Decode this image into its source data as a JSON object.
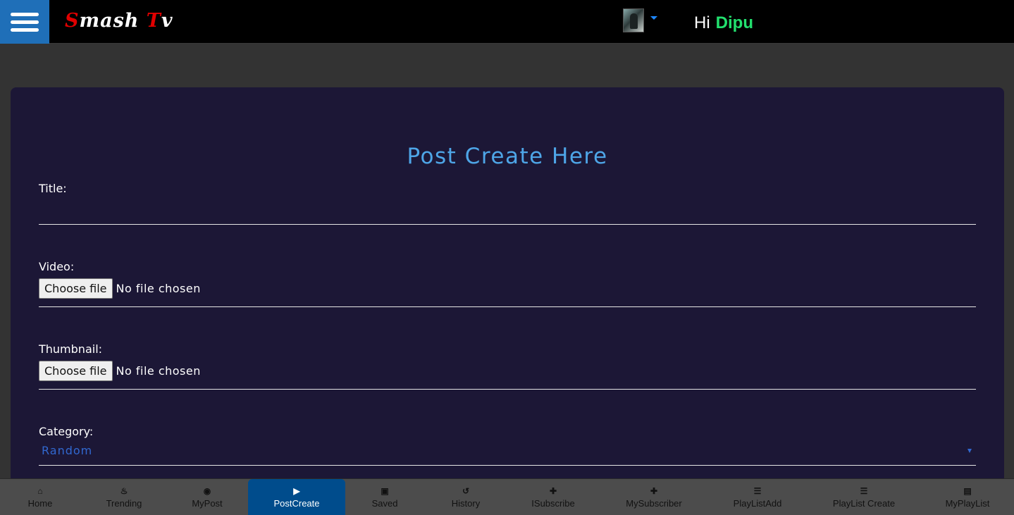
{
  "header": {
    "brand_first": "S",
    "brand_rest_1": "mash ",
    "brand_second": "T",
    "brand_rest_2": "v",
    "greeting": "Hi",
    "user_name": "Dipu"
  },
  "form": {
    "title": "Post Create Here",
    "title_label": "Title:",
    "title_value": "",
    "video_label": "Video:",
    "video_button": "Choose file",
    "video_status": "No file chosen",
    "thumbnail_label": "Thumbnail:",
    "thumbnail_button": "Choose file",
    "thumbnail_status": "No file chosen",
    "category_label": "Category:",
    "category_value": "Random"
  },
  "nav": {
    "items": [
      {
        "label": "Home",
        "icon": "home-icon",
        "glyph": "⌂"
      },
      {
        "label": "Trending",
        "icon": "fire-icon",
        "glyph": "♨"
      },
      {
        "label": "MyPost",
        "icon": "eye-icon",
        "glyph": "◉"
      },
      {
        "label": "PostCreate",
        "icon": "video-camera-icon",
        "glyph": "▶"
      },
      {
        "label": "Saved",
        "icon": "save-icon",
        "glyph": "▣"
      },
      {
        "label": "History",
        "icon": "history-icon",
        "glyph": "↺"
      },
      {
        "label": "ISubscribe",
        "icon": "user-plus-icon",
        "glyph": "✚"
      },
      {
        "label": "MySubscriber",
        "icon": "user-plus-icon",
        "glyph": "✚"
      },
      {
        "label": "PlayListAdd",
        "icon": "list-icon",
        "glyph": "☰"
      },
      {
        "label": "PlayList Create",
        "icon": "list-icon",
        "glyph": "☰"
      },
      {
        "label": "MyPlayList",
        "icon": "list-alt-icon",
        "glyph": "▤"
      }
    ],
    "active": "PostCreate"
  },
  "colors": {
    "menu_button": "#1f6fb8",
    "brand_accent": "#e10000",
    "user_name": "#22e06e",
    "form_title": "#4ea6e8",
    "card_bg": "#1c1736",
    "nav_active": "#004c8c"
  }
}
